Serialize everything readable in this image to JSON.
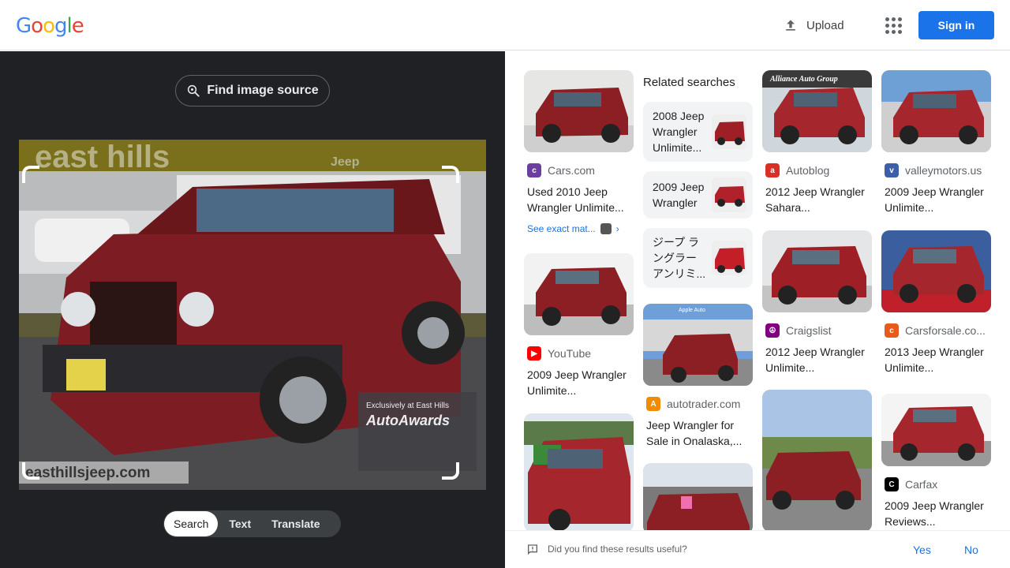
{
  "header": {
    "logo_letters": [
      {
        "ch": "G",
        "color": "#4285F4"
      },
      {
        "ch": "o",
        "color": "#EA4335"
      },
      {
        "ch": "o",
        "color": "#FBBC05"
      },
      {
        "ch": "g",
        "color": "#4285F4"
      },
      {
        "ch": "l",
        "color": "#34A853"
      },
      {
        "ch": "e",
        "color": "#EA4335"
      }
    ],
    "upload_label": "Upload",
    "apps_icon": "apps-grid-icon",
    "signin_label": "Sign in"
  },
  "left": {
    "find_source_label": "Find image source",
    "image_texts": {
      "banner": "east hills",
      "dealer_url": "easthillsjeep.com",
      "badge": "AutoAwards",
      "badge_caption": "Exclusively at East Hills",
      "plate": "Jeep"
    },
    "modes": [
      {
        "label": "Search",
        "active": true
      },
      {
        "label": "Text",
        "active": false
      },
      {
        "label": "Translate",
        "active": false
      }
    ]
  },
  "results": {
    "related_heading": "Related searches",
    "related": [
      {
        "text": "2008 Jeep Wrangler Unlimite..."
      },
      {
        "text": "2009 Jeep Wrangler"
      },
      {
        "text": "ジープ ラングラー アンリミ..."
      }
    ],
    "cards": [
      {
        "source": "Cars.com",
        "fav_color": "#6b3fa0",
        "fav_char": "c",
        "title": "Used 2010 Jeep Wrangler Unlimite...",
        "exact": "See exact mat..."
      },
      {
        "source": "YouTube",
        "fav_color": "#ff0000",
        "fav_char": "▶",
        "title": "2009 Jeep Wrangler Unlimite..."
      },
      {
        "source": "autotrader.com",
        "fav_color": "#f28b00",
        "fav_char": "A",
        "title": "Jeep Wrangler for Sale in Onalaska,..."
      },
      {
        "source": "Autoblog",
        "fav_color": "#d93025",
        "fav_char": "a",
        "title": "2012 Jeep Wrangler Sahara..."
      },
      {
        "source": "Craigslist",
        "fav_color": "#800080",
        "fav_char": "☮",
        "title": "2012 Jeep Wrangler Unlimite..."
      },
      {
        "source": "valleymotors.us",
        "fav_color": "#3c5fa8",
        "fav_char": "v",
        "title": "2009 Jeep Wrangler Unlimite..."
      },
      {
        "source": "Carsforsale.co...",
        "fav_color": "#e8591c",
        "fav_char": "c",
        "title": "2013 Jeep Wrangler Unlimite..."
      },
      {
        "source": "Carfax",
        "fav_color": "#000000",
        "fav_char": "C",
        "title": "2009 Jeep Wrangler Reviews..."
      }
    ],
    "thumb_texts": {
      "alliance": "Alliance Auto Group",
      "autotrader_banner": "Apple Auto"
    }
  },
  "feedback": {
    "question": "Did you find these results useful?",
    "yes": "Yes",
    "no": "No"
  },
  "colors": {
    "accent": "#1a73e8",
    "left_panel_bg": "#202124",
    "jeep_red": "#8b1f24"
  }
}
